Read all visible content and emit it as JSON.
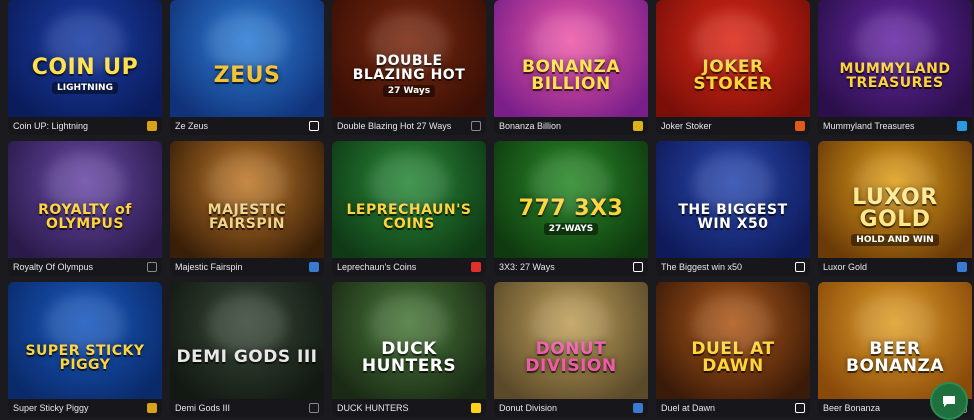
{
  "games": [
    {
      "name": "Coin UP: Lightning",
      "art": "COIN UP",
      "art_sub": "LIGHTNING",
      "bg": "#1b3fa8",
      "bg2": "#0b1c5c",
      "fg": "#ffe04a",
      "provider": "provider-gold-icon",
      "prov_color": "#d9a21b"
    },
    {
      "name": "Ze Zeus",
      "art": "ZEUS",
      "art_sub": "",
      "bg": "#2f7fd6",
      "bg2": "#10327a",
      "fg": "#f2c233",
      "provider": "provider-h-icon",
      "prov_color": "#ffffff"
    },
    {
      "name": "Double Blazing Hot 27 Ways",
      "art": "DOUBLE BLAZING HOT",
      "art_sub": "27 Ways",
      "bg": "#7a2a10",
      "bg2": "#3a0f05",
      "fg": "#ffffff",
      "provider": "provider-dots-icon",
      "prov_color": "#888888"
    },
    {
      "name": "Bonanza Billion",
      "art": "BONANZA BILLION",
      "art_sub": "",
      "bg": "#f05aa8",
      "bg2": "#7a1f8a",
      "fg": "#ffe14a",
      "provider": "provider-gold-icon",
      "prov_color": "#e0b21a"
    },
    {
      "name": "Joker Stoker",
      "art": "JOKER STOKER",
      "art_sub": "",
      "bg": "#e02a1a",
      "bg2": "#7a0f08",
      "fg": "#ffd43a",
      "provider": "provider-e-icon",
      "prov_color": "#e05a1a"
    },
    {
      "name": "Mummyland Treasures",
      "art": "MUMMYLAND TREASURES",
      "art_sub": "",
      "bg": "#6a2aa8",
      "bg2": "#2a0f4a",
      "fg": "#ffd43a",
      "provider": "provider-bird-icon",
      "prov_color": "#2a9ae0"
    },
    {
      "name": "Royalty Of Olympus",
      "art": "ROYALTY of OLYMPUS",
      "art_sub": "",
      "bg": "#6a4aa8",
      "bg2": "#2a1a4a",
      "fg": "#ffd43a",
      "provider": "provider-dots-icon",
      "prov_color": "#888888"
    },
    {
      "name": "Majestic Fairspin",
      "art": "MAJESTIC FAIRSPIN",
      "art_sub": "",
      "bg": "#c07a2a",
      "bg2": "#3a1f08",
      "fg": "#f2d48a",
      "provider": "provider-box-icon",
      "prov_color": "#3a7ad0"
    },
    {
      "name": "Leprechaun's Coins",
      "art": "LEPRECHAUN'S COINS",
      "art_sub": "",
      "bg": "#2a8a3a",
      "bg2": "#0f3a15",
      "fg": "#ffd43a",
      "provider": "provider-p-icon",
      "prov_color": "#e0302a"
    },
    {
      "name": "3X3: 27 Ways",
      "art": "777 3X3",
      "art_sub": "27-WAYS",
      "bg": "#2a8a2a",
      "bg2": "#0f3a0f",
      "fg": "#ffd43a",
      "provider": "provider-g-icon",
      "prov_color": "#ffffff"
    },
    {
      "name": "The Biggest win x50",
      "art": "THE BIGGEST WIN X50",
      "art_sub": "",
      "bg": "#2a4ab0",
      "bg2": "#0f1a5a",
      "fg": "#ffffff",
      "provider": "provider-qr-icon",
      "prov_color": "#ffffff"
    },
    {
      "name": "Luxor Gold",
      "art": "LUXOR GOLD",
      "art_sub": "HOLD AND WIN",
      "bg": "#e0a01a",
      "bg2": "#6a3a08",
      "fg": "#ffe88a",
      "provider": "provider-box-icon",
      "prov_color": "#3a7ad0"
    },
    {
      "name": "Super Sticky Piggy",
      "art": "SUPER STICKY PIGGY",
      "art_sub": "",
      "bg": "#1a5ac0",
      "bg2": "#0a2a6a",
      "fg": "#ffd43a",
      "provider": "provider-gold-icon",
      "prov_color": "#d9a21b"
    },
    {
      "name": "Demi Gods III",
      "art": "DEMI GODS III",
      "art_sub": "",
      "bg": "#3a4a3a",
      "bg2": "#121812",
      "fg": "#e8e8e8",
      "provider": "provider-s-icon",
      "prov_color": "#888888"
    },
    {
      "name": "DUCK HUNTERS",
      "art": "DUCK HUNTERS",
      "art_sub": "",
      "bg": "#4a7a3a",
      "bg2": "#1a2a15",
      "fg": "#ffffff",
      "provider": "provider-bolt-icon",
      "prov_color": "#ffd21a"
    },
    {
      "name": "Donut Division",
      "art": "DONUT DIVISION",
      "art_sub": "",
      "bg": "#c0a05a",
      "bg2": "#5a4a2a",
      "fg": "#f05aa8",
      "provider": "provider-box-icon",
      "prov_color": "#3a7ad0"
    },
    {
      "name": "Duel at Dawn",
      "art": "DUEL AT DAWN",
      "art_sub": "",
      "bg": "#b05a1a",
      "bg2": "#3a1a08",
      "fg": "#ffd43a",
      "provider": "provider-h-icon",
      "prov_color": "#ffffff"
    },
    {
      "name": "Beer Bonanza",
      "art": "BEER BONANZA",
      "art_sub": "",
      "bg": "#e0a02a",
      "bg2": "#8a4a0a",
      "fg": "#ffffff",
      "provider": "provider-s-icon",
      "prov_color": "#888888"
    }
  ]
}
